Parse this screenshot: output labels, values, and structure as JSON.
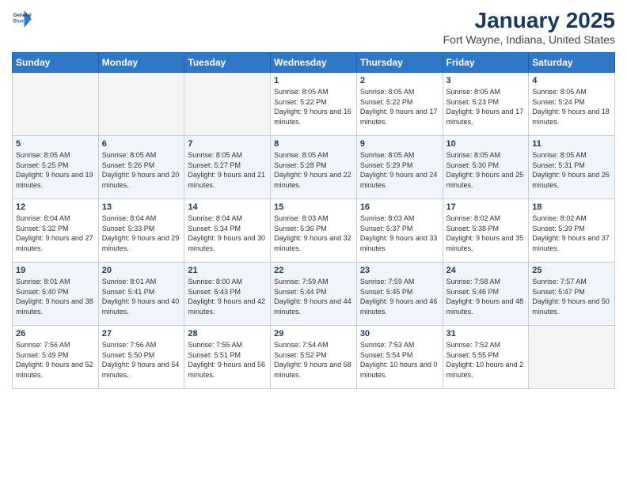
{
  "header": {
    "logo_line1": "General",
    "logo_line2": "Blue",
    "month": "January 2025",
    "location": "Fort Wayne, Indiana, United States"
  },
  "weekdays": [
    "Sunday",
    "Monday",
    "Tuesday",
    "Wednesday",
    "Thursday",
    "Friday",
    "Saturday"
  ],
  "weeks": [
    [
      {
        "day": "",
        "sunrise": "",
        "sunset": "",
        "daylight": "",
        "empty": true
      },
      {
        "day": "",
        "sunrise": "",
        "sunset": "",
        "daylight": "",
        "empty": true
      },
      {
        "day": "",
        "sunrise": "",
        "sunset": "",
        "daylight": "",
        "empty": true
      },
      {
        "day": "1",
        "sunrise": "Sunrise: 8:05 AM",
        "sunset": "Sunset: 5:22 PM",
        "daylight": "Daylight: 9 hours and 16 minutes.",
        "empty": false
      },
      {
        "day": "2",
        "sunrise": "Sunrise: 8:05 AM",
        "sunset": "Sunset: 5:22 PM",
        "daylight": "Daylight: 9 hours and 17 minutes.",
        "empty": false
      },
      {
        "day": "3",
        "sunrise": "Sunrise: 8:05 AM",
        "sunset": "Sunset: 5:23 PM",
        "daylight": "Daylight: 9 hours and 17 minutes.",
        "empty": false
      },
      {
        "day": "4",
        "sunrise": "Sunrise: 8:05 AM",
        "sunset": "Sunset: 5:24 PM",
        "daylight": "Daylight: 9 hours and 18 minutes.",
        "empty": false
      }
    ],
    [
      {
        "day": "5",
        "sunrise": "Sunrise: 8:05 AM",
        "sunset": "Sunset: 5:25 PM",
        "daylight": "Daylight: 9 hours and 19 minutes.",
        "empty": false
      },
      {
        "day": "6",
        "sunrise": "Sunrise: 8:05 AM",
        "sunset": "Sunset: 5:26 PM",
        "daylight": "Daylight: 9 hours and 20 minutes.",
        "empty": false
      },
      {
        "day": "7",
        "sunrise": "Sunrise: 8:05 AM",
        "sunset": "Sunset: 5:27 PM",
        "daylight": "Daylight: 9 hours and 21 minutes.",
        "empty": false
      },
      {
        "day": "8",
        "sunrise": "Sunrise: 8:05 AM",
        "sunset": "Sunset: 5:28 PM",
        "daylight": "Daylight: 9 hours and 22 minutes.",
        "empty": false
      },
      {
        "day": "9",
        "sunrise": "Sunrise: 8:05 AM",
        "sunset": "Sunset: 5:29 PM",
        "daylight": "Daylight: 9 hours and 24 minutes.",
        "empty": false
      },
      {
        "day": "10",
        "sunrise": "Sunrise: 8:05 AM",
        "sunset": "Sunset: 5:30 PM",
        "daylight": "Daylight: 9 hours and 25 minutes.",
        "empty": false
      },
      {
        "day": "11",
        "sunrise": "Sunrise: 8:05 AM",
        "sunset": "Sunset: 5:31 PM",
        "daylight": "Daylight: 9 hours and 26 minutes.",
        "empty": false
      }
    ],
    [
      {
        "day": "12",
        "sunrise": "Sunrise: 8:04 AM",
        "sunset": "Sunset: 5:32 PM",
        "daylight": "Daylight: 9 hours and 27 minutes.",
        "empty": false
      },
      {
        "day": "13",
        "sunrise": "Sunrise: 8:04 AM",
        "sunset": "Sunset: 5:33 PM",
        "daylight": "Daylight: 9 hours and 29 minutes.",
        "empty": false
      },
      {
        "day": "14",
        "sunrise": "Sunrise: 8:04 AM",
        "sunset": "Sunset: 5:34 PM",
        "daylight": "Daylight: 9 hours and 30 minutes.",
        "empty": false
      },
      {
        "day": "15",
        "sunrise": "Sunrise: 8:03 AM",
        "sunset": "Sunset: 5:36 PM",
        "daylight": "Daylight: 9 hours and 32 minutes.",
        "empty": false
      },
      {
        "day": "16",
        "sunrise": "Sunrise: 8:03 AM",
        "sunset": "Sunset: 5:37 PM",
        "daylight": "Daylight: 9 hours and 33 minutes.",
        "empty": false
      },
      {
        "day": "17",
        "sunrise": "Sunrise: 8:02 AM",
        "sunset": "Sunset: 5:38 PM",
        "daylight": "Daylight: 9 hours and 35 minutes.",
        "empty": false
      },
      {
        "day": "18",
        "sunrise": "Sunrise: 8:02 AM",
        "sunset": "Sunset: 5:39 PM",
        "daylight": "Daylight: 9 hours and 37 minutes.",
        "empty": false
      }
    ],
    [
      {
        "day": "19",
        "sunrise": "Sunrise: 8:01 AM",
        "sunset": "Sunset: 5:40 PM",
        "daylight": "Daylight: 9 hours and 38 minutes.",
        "empty": false
      },
      {
        "day": "20",
        "sunrise": "Sunrise: 8:01 AM",
        "sunset": "Sunset: 5:41 PM",
        "daylight": "Daylight: 9 hours and 40 minutes.",
        "empty": false
      },
      {
        "day": "21",
        "sunrise": "Sunrise: 8:00 AM",
        "sunset": "Sunset: 5:43 PM",
        "daylight": "Daylight: 9 hours and 42 minutes.",
        "empty": false
      },
      {
        "day": "22",
        "sunrise": "Sunrise: 7:59 AM",
        "sunset": "Sunset: 5:44 PM",
        "daylight": "Daylight: 9 hours and 44 minutes.",
        "empty": false
      },
      {
        "day": "23",
        "sunrise": "Sunrise: 7:59 AM",
        "sunset": "Sunset: 5:45 PM",
        "daylight": "Daylight: 9 hours and 46 minutes.",
        "empty": false
      },
      {
        "day": "24",
        "sunrise": "Sunrise: 7:58 AM",
        "sunset": "Sunset: 5:46 PM",
        "daylight": "Daylight: 9 hours and 48 minutes.",
        "empty": false
      },
      {
        "day": "25",
        "sunrise": "Sunrise: 7:57 AM",
        "sunset": "Sunset: 5:47 PM",
        "daylight": "Daylight: 9 hours and 50 minutes.",
        "empty": false
      }
    ],
    [
      {
        "day": "26",
        "sunrise": "Sunrise: 7:56 AM",
        "sunset": "Sunset: 5:49 PM",
        "daylight": "Daylight: 9 hours and 52 minutes.",
        "empty": false
      },
      {
        "day": "27",
        "sunrise": "Sunrise: 7:56 AM",
        "sunset": "Sunset: 5:50 PM",
        "daylight": "Daylight: 9 hours and 54 minutes.",
        "empty": false
      },
      {
        "day": "28",
        "sunrise": "Sunrise: 7:55 AM",
        "sunset": "Sunset: 5:51 PM",
        "daylight": "Daylight: 9 hours and 56 minutes.",
        "empty": false
      },
      {
        "day": "29",
        "sunrise": "Sunrise: 7:54 AM",
        "sunset": "Sunset: 5:52 PM",
        "daylight": "Daylight: 9 hours and 58 minutes.",
        "empty": false
      },
      {
        "day": "30",
        "sunrise": "Sunrise: 7:53 AM",
        "sunset": "Sunset: 5:54 PM",
        "daylight": "Daylight: 10 hours and 0 minutes.",
        "empty": false
      },
      {
        "day": "31",
        "sunrise": "Sunrise: 7:52 AM",
        "sunset": "Sunset: 5:55 PM",
        "daylight": "Daylight: 10 hours and 2 minutes.",
        "empty": false
      },
      {
        "day": "",
        "sunrise": "",
        "sunset": "",
        "daylight": "",
        "empty": true
      }
    ]
  ]
}
